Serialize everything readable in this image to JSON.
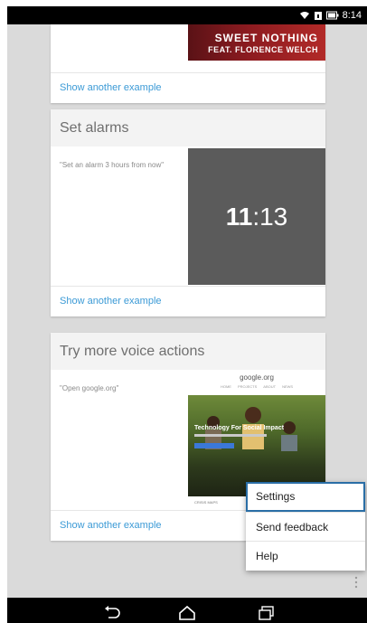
{
  "status_bar": {
    "time": "8:14"
  },
  "music_card": {
    "song_title": "SWEET NOTHING",
    "song_artist": "FEAT. FLORENCE WELCH",
    "link": "Show another example"
  },
  "alarms_card": {
    "title": "Set alarms",
    "example": "\"Set an alarm 3 hours from now\"",
    "clock_hours": "11",
    "clock_minutes": ":13",
    "link": "Show another example"
  },
  "voice_card": {
    "title": "Try more voice actions",
    "example": "\"Open google.org\"",
    "preview": {
      "logo": "google.org",
      "nav": [
        "HOME",
        "PROJECTS",
        "ABOUT",
        "NEWS"
      ],
      "hero_title": "Technology For Social Impact",
      "footer": "CRISIS MAPS"
    },
    "link": "Show another example"
  },
  "popup_menu": {
    "items": [
      "Settings",
      "Send feedback",
      "Help"
    ]
  },
  "colors": {
    "link": "#3b9ad6",
    "clock_tile": "#5b5b5b",
    "menu_focus": "#2a6ea6"
  }
}
